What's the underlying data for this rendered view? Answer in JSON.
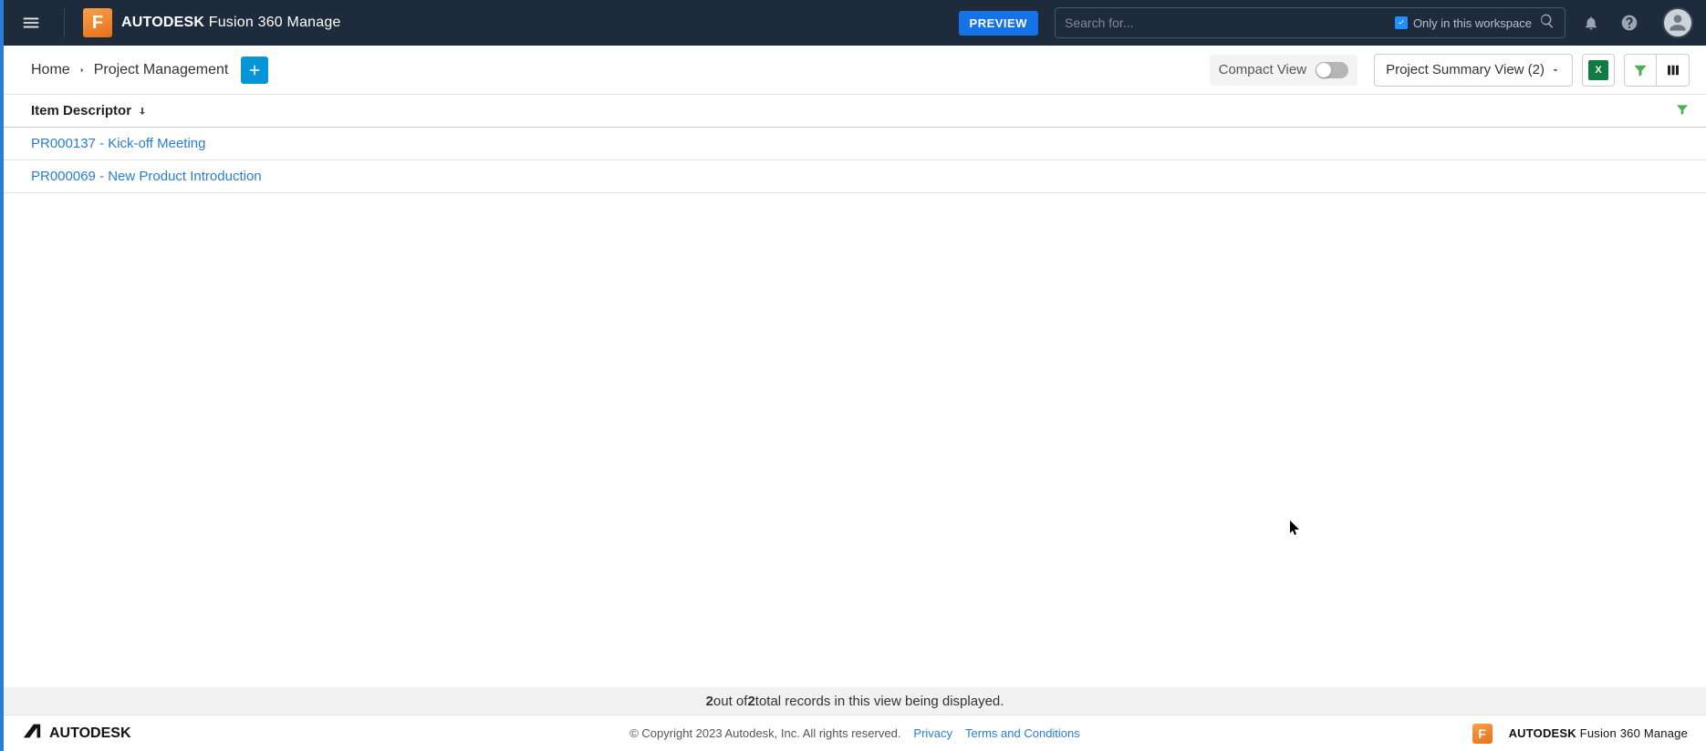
{
  "header": {
    "brand_bold": "AUTODESK",
    "brand_light": " Fusion 360 Manage",
    "preview": "PREVIEW",
    "search_placeholder": "Search for...",
    "workspace_label": "Only in this workspace"
  },
  "breadcrumb": {
    "home": "Home",
    "current": "Project Management"
  },
  "toolbar": {
    "compact_label": "Compact View",
    "view_label": "Project Summary View (2)"
  },
  "table": {
    "column": "Item Descriptor",
    "rows": [
      "PR000137 - Kick-off Meeting",
      "PR000069 - New Product Introduction"
    ]
  },
  "status": {
    "a": "2",
    "mid1": " out of ",
    "b": "2",
    "mid2": " total records in this view being displayed."
  },
  "footer": {
    "autodesk": "AUTODESK",
    "copyright": "© Copyright 2023 Autodesk, Inc. All rights reserved.",
    "privacy": "Privacy",
    "terms": "Terms and Conditions",
    "brand_bold": "AUTODESK",
    "brand_light": " Fusion 360 Manage"
  }
}
